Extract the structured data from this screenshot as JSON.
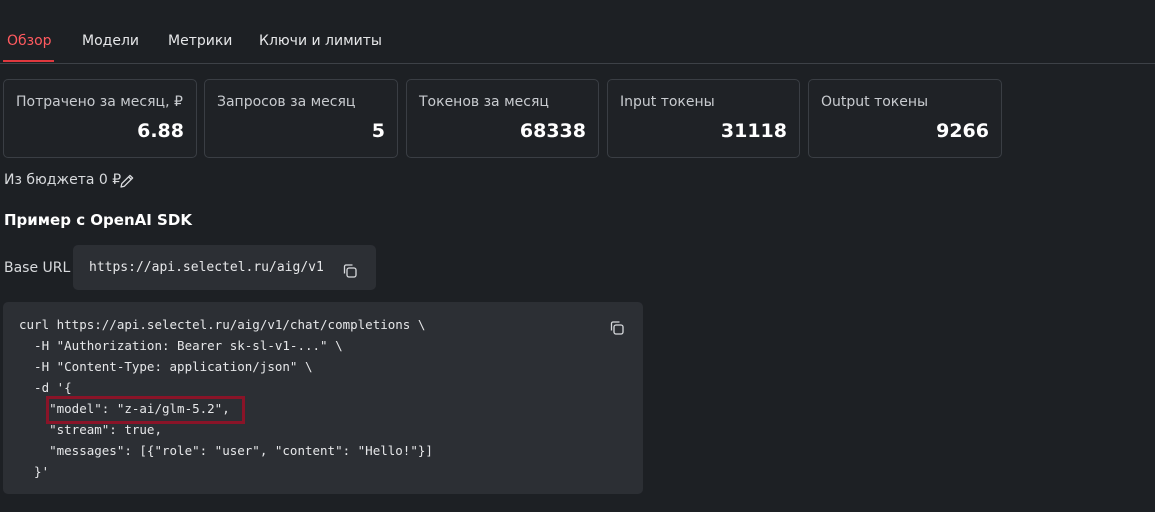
{
  "tabs": [
    {
      "label": "Обзор",
      "active": true
    },
    {
      "label": "Модели",
      "active": false
    },
    {
      "label": "Метрики",
      "active": false
    },
    {
      "label": "Ключи и лимиты",
      "active": false
    }
  ],
  "stats": [
    {
      "label": "Потрачено за месяц, ₽",
      "value": "6.88"
    },
    {
      "label": "Запросов за месяц",
      "value": "5"
    },
    {
      "label": "Токенов за месяц",
      "value": "68338"
    },
    {
      "label": "Input токены",
      "value": "31118"
    },
    {
      "label": "Output токены",
      "value": "9266"
    }
  ],
  "budget": {
    "text": "Из бюджета 0 ₽",
    "edit_icon": "pencil-icon"
  },
  "example": {
    "title": "Пример с OpenAI SDK",
    "base_url_label": "Base URL",
    "base_url": "https://api.selectel.ru/aig/v1",
    "copy_icon": "copy-icon",
    "code_lines": [
      "curl https://api.selectel.ru/aig/v1/chat/completions \\",
      "  -H \"Authorization: Bearer sk-sl-v1-...\" \\",
      "  -H \"Content-Type: application/json\" \\",
      "  -d '{",
      "    \"model\": \"z-ai/glm-5.2\",",
      "    \"stream\": true,",
      "    \"messages\": [{\"role\": \"user\", \"content\": \"Hello!\"}]",
      "  }'"
    ]
  },
  "colors": {
    "background": "#1d2024",
    "accent": "#e0383e",
    "highlight_box": "#8a1428",
    "panel": "#2c2f34"
  }
}
